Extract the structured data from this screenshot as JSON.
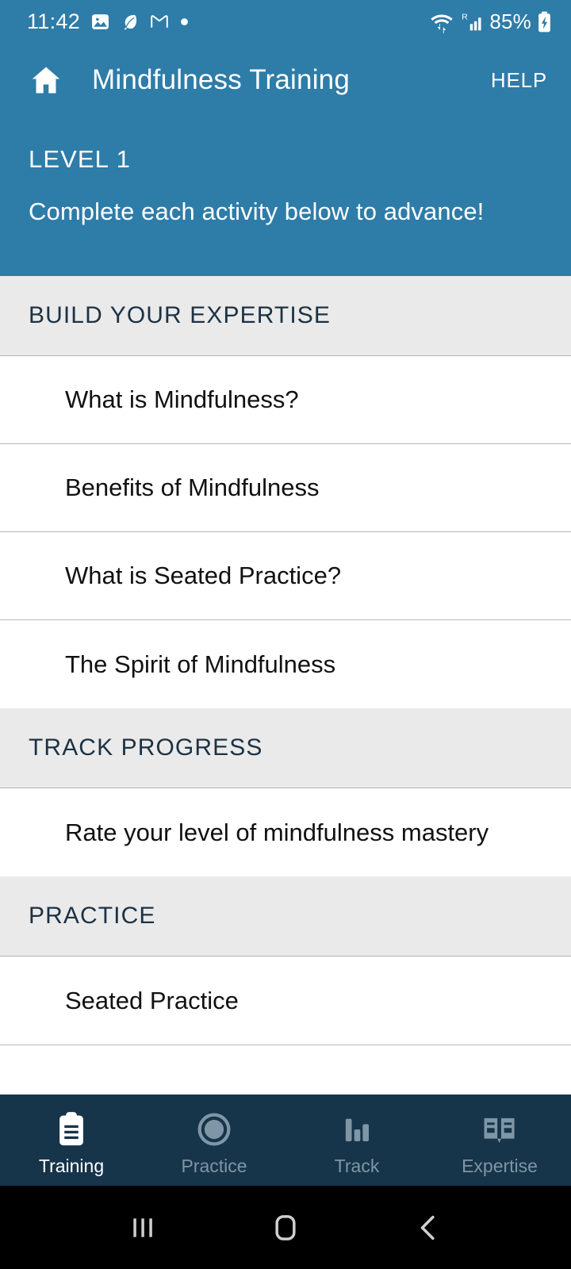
{
  "statusbar": {
    "time": "11:42",
    "battery_percent": "85%",
    "left_icons": [
      "photos-icon",
      "leaf-icon",
      "gmail-icon",
      "dot-icon"
    ],
    "right_icons": [
      "wifi-icon",
      "roaming-signal-icon",
      "battery-charging-icon"
    ]
  },
  "appbar": {
    "home_icon": "home-icon",
    "title": "Mindfulness Training",
    "help_label": "HELP"
  },
  "banner": {
    "level": "LEVEL 1",
    "subtitle": "Complete each activity below to advance!"
  },
  "sections": [
    {
      "header": "BUILD YOUR EXPERTISE",
      "items": [
        "What is Mindfulness?",
        "Benefits of Mindfulness",
        "What is Seated Practice?",
        "The Spirit of Mindfulness"
      ]
    },
    {
      "header": "TRACK PROGRESS",
      "items": [
        "Rate your level of mindfulness mastery"
      ]
    },
    {
      "header": "PRACTICE",
      "items": [
        "Seated Practice"
      ]
    }
  ],
  "tabs": [
    {
      "label": "Training",
      "icon": "clipboard-icon",
      "active": true
    },
    {
      "label": "Practice",
      "icon": "circle-ring-icon",
      "active": false
    },
    {
      "label": "Track",
      "icon": "bar-chart-icon",
      "active": false
    },
    {
      "label": "Expertise",
      "icon": "open-book-icon",
      "active": false
    }
  ],
  "navbar": {
    "recents_label": "recents-icon",
    "home_label": "home-square-icon",
    "back_label": "back-chevron-icon"
  },
  "colors": {
    "header_blue": "#2E7CA8",
    "tabbar_navy": "#16344A",
    "section_gray": "#EAEAEA",
    "section_text": "#1C3244",
    "row_text": "#111111",
    "inactive_tab": "#7F96A6"
  }
}
